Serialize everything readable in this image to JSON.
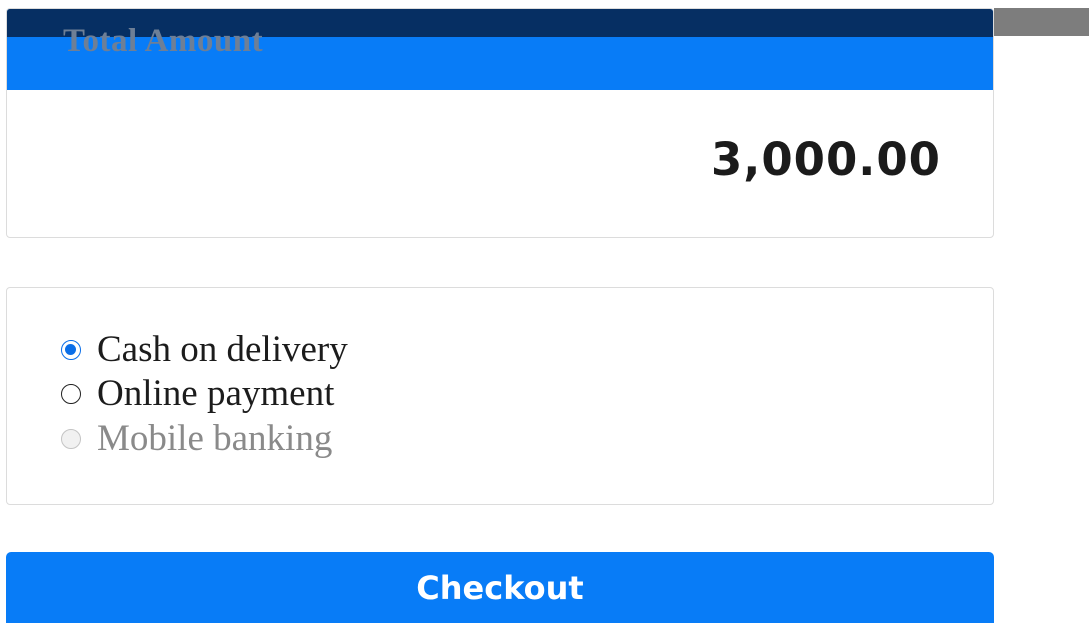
{
  "total": {
    "title": "Total Amount",
    "amount": "3,000.00"
  },
  "payment": {
    "options": [
      {
        "label": "Cash on delivery",
        "selected": true,
        "disabled": false
      },
      {
        "label": "Online payment",
        "selected": false,
        "disabled": false
      },
      {
        "label": "Mobile banking",
        "selected": false,
        "disabled": true
      }
    ]
  },
  "checkout": {
    "label": "Checkout"
  },
  "colors": {
    "primary": "#087cf7",
    "overlay": "#062f63"
  }
}
